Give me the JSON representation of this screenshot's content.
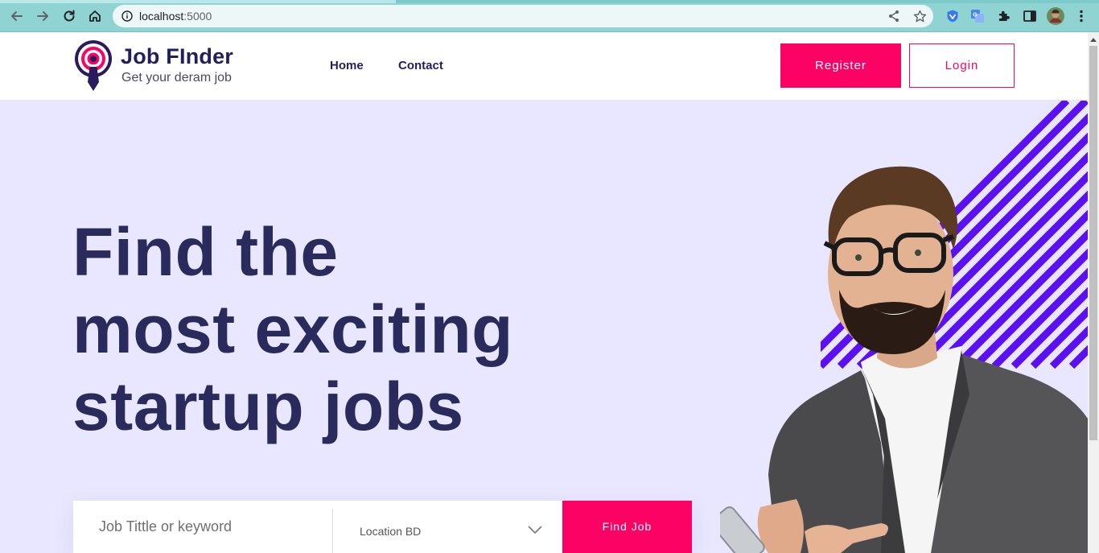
{
  "browser": {
    "url_host": "localhost",
    "url_port": ":5000"
  },
  "header": {
    "brand_name": "Job FInder",
    "brand_tagline": "Get your deram job",
    "nav": [
      {
        "label": "Home"
      },
      {
        "label": "Contact"
      }
    ],
    "register_label": "Register",
    "login_label": "Login"
  },
  "hero": {
    "title_lines": [
      "Find the",
      "most exciting",
      "startup jobs"
    ]
  },
  "search": {
    "keyword_placeholder": "Job Tittle or keyword",
    "location_value": "Location BD",
    "find_label": "Find Job"
  },
  "colors": {
    "accent": "#fb0264",
    "brand_dark": "#221f5c",
    "hero_bg": "#e9e6ff",
    "stripe": "#5a10f0",
    "browser_chrome": "#8fd3d3"
  },
  "icons": [
    "back-icon",
    "forward-icon",
    "reload-icon",
    "home-icon",
    "site-info-icon",
    "share-icon",
    "bookmark-star-icon",
    "shield-extension-icon",
    "translate-extension-icon",
    "extensions-puzzle-icon",
    "side-panel-icon",
    "profile-avatar",
    "more-menu-icon",
    "chevron-down-icon",
    "logo-icon"
  ]
}
